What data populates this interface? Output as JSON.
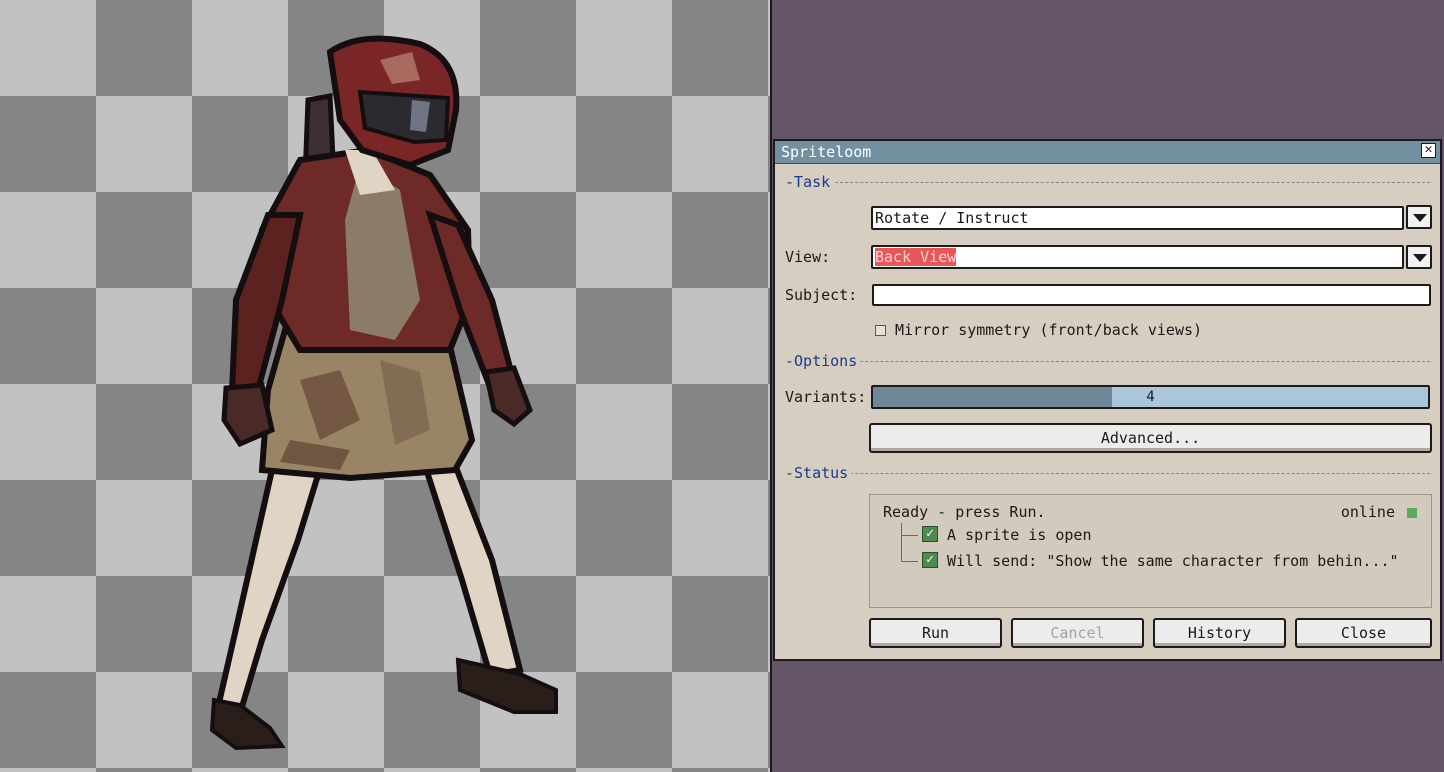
{
  "dialog": {
    "title": "Spriteloom",
    "close_glyph": "✕",
    "sections": {
      "task": "-Task",
      "options": "-Options",
      "status": "-Status"
    },
    "task": {
      "mode_value": "Rotate / Instruct",
      "view_label": "View:",
      "view_value": "Back View",
      "subject_label": "Subject:",
      "subject_value": "",
      "mirror_label": "Mirror symmetry (front/back views)",
      "mirror_checked": false
    },
    "options": {
      "variants_label": "Variants:",
      "variants_value": "4",
      "variants_fraction": 0.43,
      "advanced_label": "Advanced..."
    },
    "status": {
      "message": "Ready - press Run.",
      "connection": "online",
      "checks": [
        {
          "label": "A sprite is open",
          "checked": true
        },
        {
          "label": "Will send: \"Show the same character from behin...\"",
          "checked": true
        }
      ]
    },
    "buttons": {
      "run": "Run",
      "cancel": "Cancel",
      "history": "History",
      "close": "Close"
    }
  },
  "colors": {
    "background": "#645468",
    "titlebar": "#7390a0",
    "dialog": "#d6cec0",
    "section_label": "#1c3a8c",
    "selection": "#e8565a",
    "online": "#5caa5c"
  },
  "icons": [
    "close-icon",
    "chevron-down-icon",
    "checkbox-icon",
    "check-icon",
    "status-online-icon"
  ]
}
